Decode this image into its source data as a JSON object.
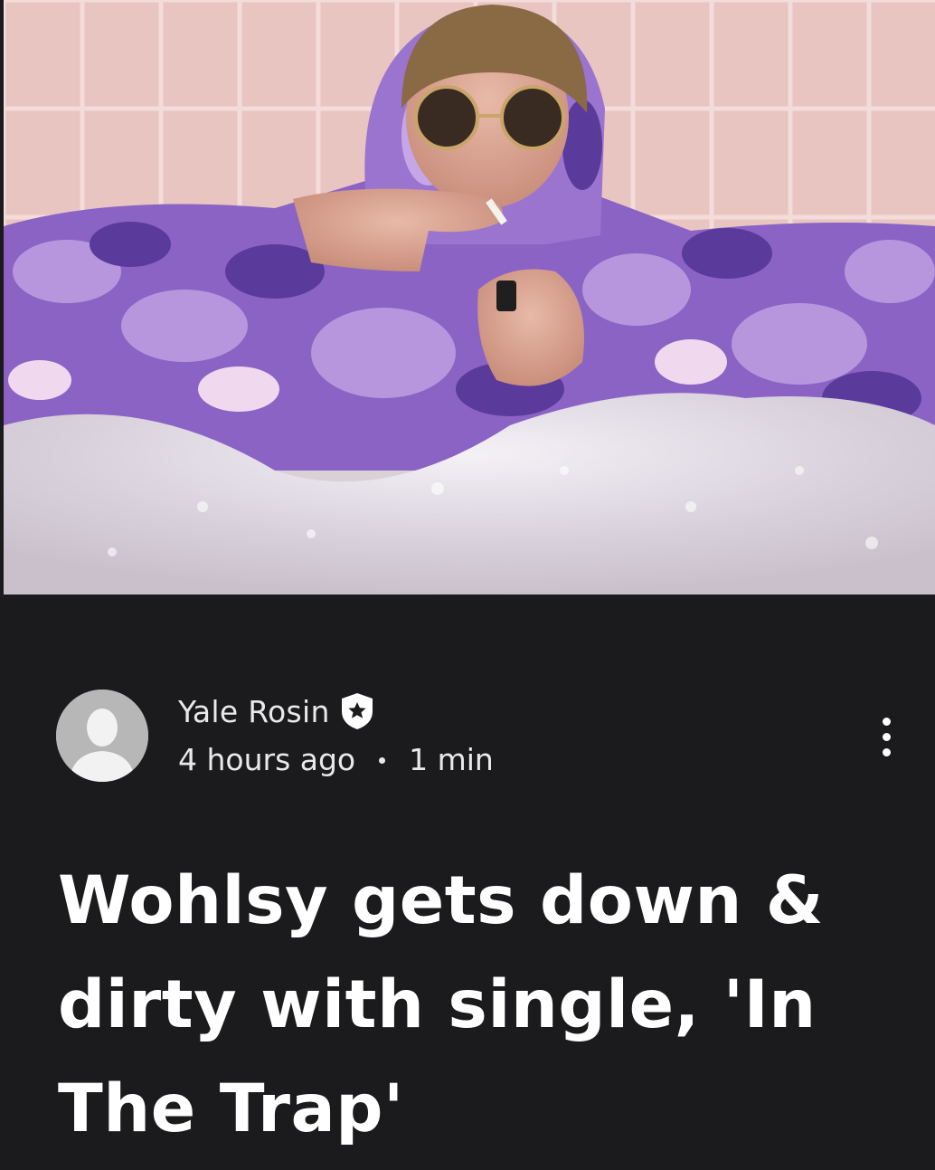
{
  "hero_image": {
    "alt": "Photo of a person in a purple camo hoodie and round sunglasses lighting a cigarette in a bubble bath"
  },
  "author": {
    "name": "Yale Rosin",
    "badge_icon": "admin-star-shield-icon",
    "avatar_icon": "default-user-avatar-icon"
  },
  "meta": {
    "posted": "4 hours ago",
    "read_time": "1 min"
  },
  "more_icon": "more-vertical-icon",
  "article": {
    "title": "Wohlsy gets down & dirty with single, 'In The Trap'"
  },
  "colors": {
    "background": "#1b1a1d",
    "text": "#ffffff",
    "muted_text": "#e9e9e9",
    "avatar_bg": "#b7b7b7"
  }
}
